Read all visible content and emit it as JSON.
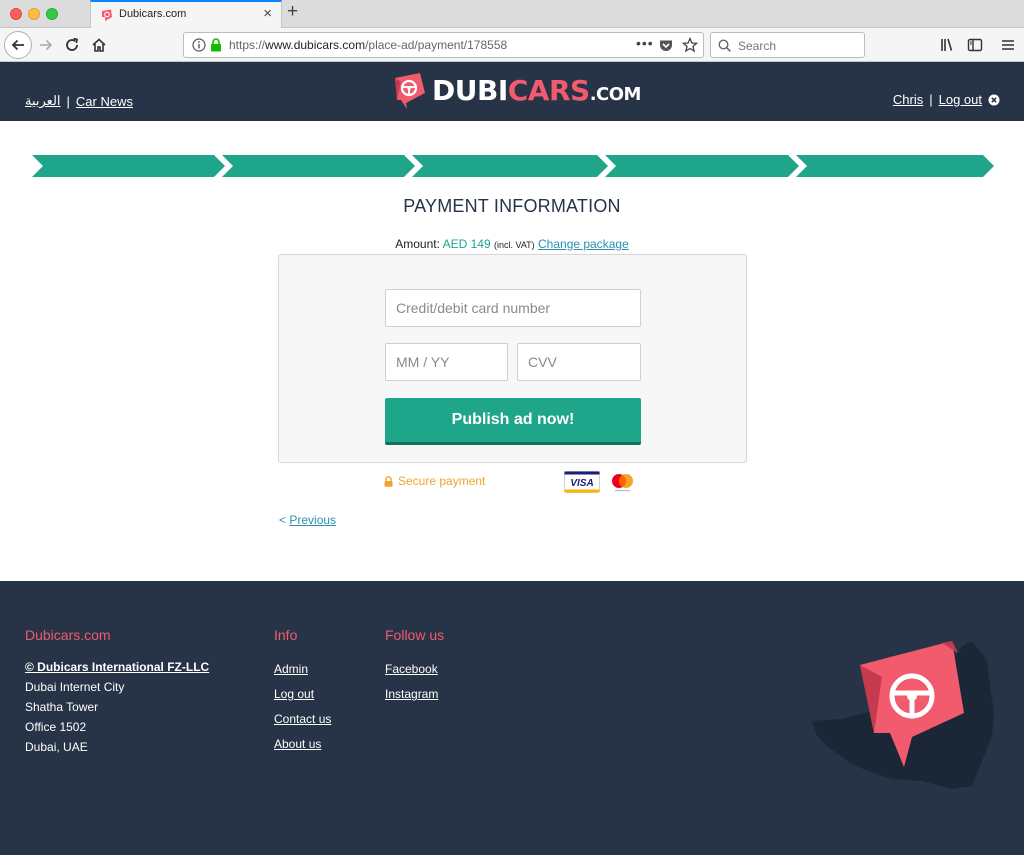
{
  "browser": {
    "tab_title": "Dubicars.com",
    "url_scheme": "https://",
    "url_host": "www.dubicars.com",
    "url_path": "/place-ad/payment/178558",
    "search_placeholder": "Search"
  },
  "header": {
    "arabic_link": "العربية",
    "car_news_link": "Car News",
    "user_link": "Chris",
    "logout_link": "Log out",
    "logo_main": "DUBI",
    "logo_accent": "CARS",
    "logo_suffix": ".COM"
  },
  "steps": {
    "count": 5,
    "color": "#1fa58a"
  },
  "payment": {
    "title": "PAYMENT INFORMATION",
    "amount_label": "Amount:",
    "amount_value": "AED 149",
    "vat_note": "(incl. VAT)",
    "change_package_link": "Change package",
    "card_placeholder": "Credit/debit card number",
    "expiry_placeholder": "MM / YY",
    "cvv_placeholder": "CVV",
    "publish_button": "Publish ad now!",
    "secure_label": "Secure payment",
    "visa_label": "VISA",
    "previous_prefix": "<",
    "previous_link": "Previous"
  },
  "footer": {
    "company": {
      "heading": "Dubicars.com",
      "copyright": "© Dubicars International FZ-LLC",
      "address": [
        "Dubai Internet City",
        "Shatha Tower",
        "Office 1502",
        "Dubai, UAE"
      ]
    },
    "info": {
      "heading": "Info",
      "links": [
        "Admin",
        "Log out",
        "Contact us",
        "About us"
      ]
    },
    "follow": {
      "heading": "Follow us",
      "links": [
        "Facebook",
        "Instagram"
      ]
    }
  },
  "colors": {
    "header_bg": "#273447",
    "accent_green": "#1fa58a",
    "brand_pink": "#f25a6e",
    "secure_orange": "#f0a430",
    "link_blue": "#2a8fb0"
  },
  "icons": [
    "back-arrow-icon",
    "forward-arrow-icon",
    "reload-icon",
    "home-icon",
    "info-icon",
    "lock-icon",
    "pocket-icon",
    "star-icon",
    "search-icon",
    "library-icon",
    "sidebar-icon",
    "hamburger-menu-icon",
    "logout-close-icon",
    "steering-wheel-icon",
    "padlock-icon",
    "visa-icon",
    "mastercard-icon"
  ]
}
